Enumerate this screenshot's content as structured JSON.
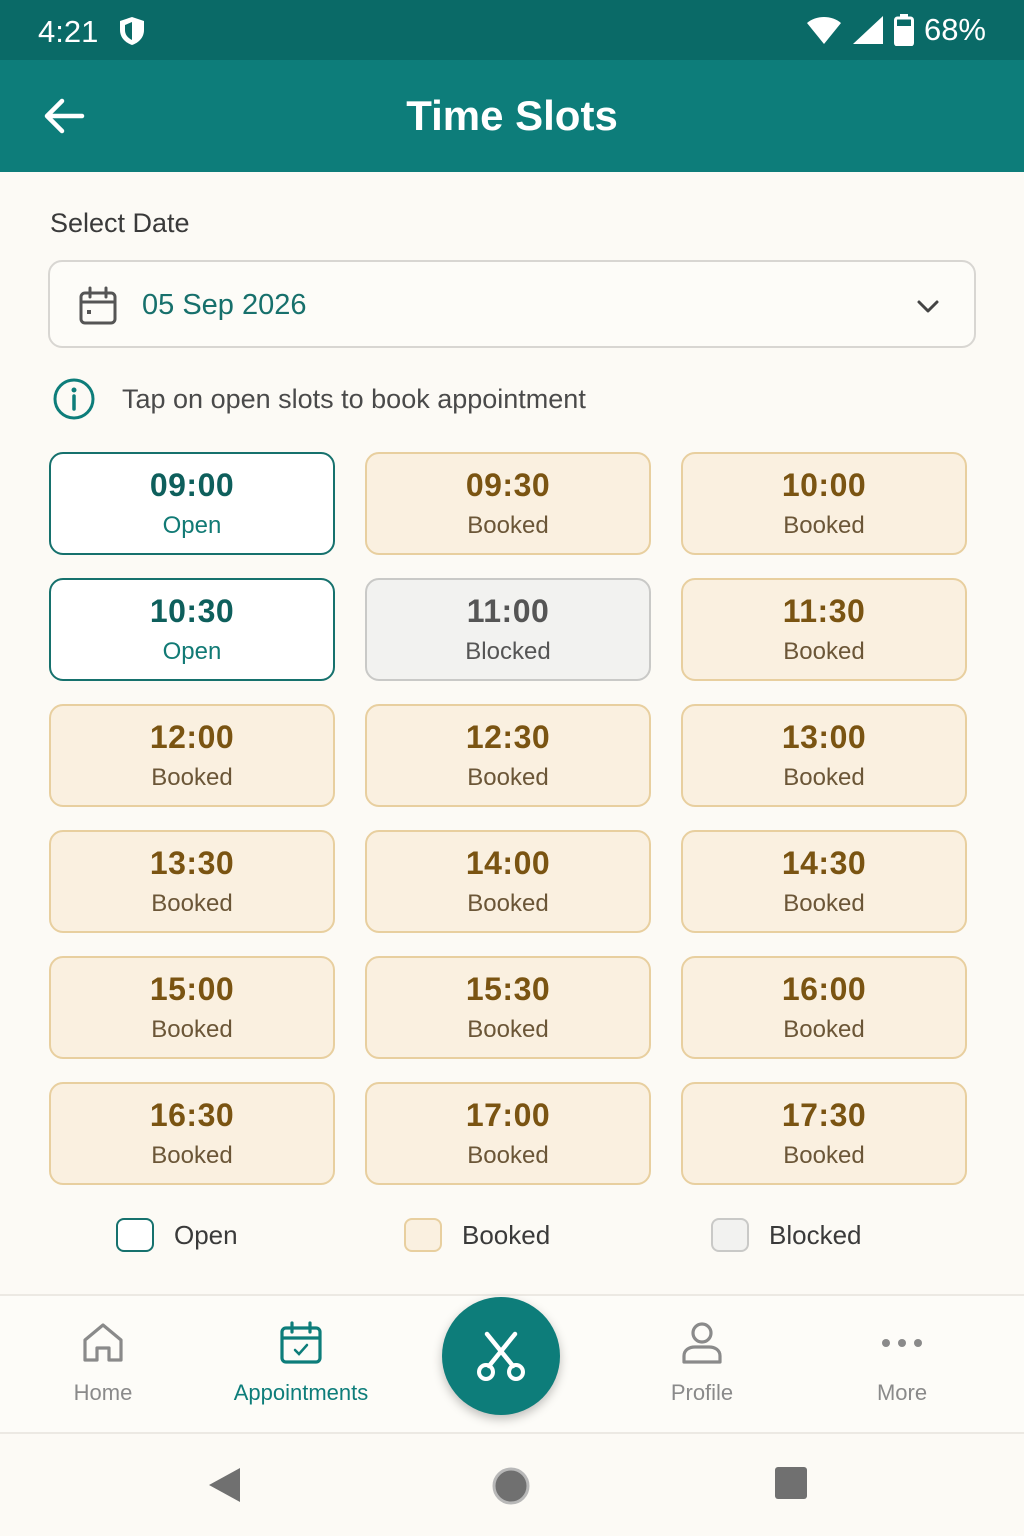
{
  "status_bar": {
    "time": "4:21",
    "battery": "68%"
  },
  "app_bar": {
    "title": "Time Slots"
  },
  "date_picker": {
    "label": "Select Date",
    "value": "05 Sep 2026"
  },
  "info": {
    "text": "Tap on open slots to book appointment"
  },
  "slots": [
    {
      "time": "09:00",
      "status": "Open",
      "state": "open"
    },
    {
      "time": "09:30",
      "status": "Booked",
      "state": "booked"
    },
    {
      "time": "10:00",
      "status": "Booked",
      "state": "booked"
    },
    {
      "time": "10:30",
      "status": "Open",
      "state": "open"
    },
    {
      "time": "11:00",
      "status": "Blocked",
      "state": "blocked"
    },
    {
      "time": "11:30",
      "status": "Booked",
      "state": "booked"
    },
    {
      "time": "12:00",
      "status": "Booked",
      "state": "booked"
    },
    {
      "time": "12:30",
      "status": "Booked",
      "state": "booked"
    },
    {
      "time": "13:00",
      "status": "Booked",
      "state": "booked"
    },
    {
      "time": "13:30",
      "status": "Booked",
      "state": "booked"
    },
    {
      "time": "14:00",
      "status": "Booked",
      "state": "booked"
    },
    {
      "time": "14:30",
      "status": "Booked",
      "state": "booked"
    },
    {
      "time": "15:00",
      "status": "Booked",
      "state": "booked"
    },
    {
      "time": "15:30",
      "status": "Booked",
      "state": "booked"
    },
    {
      "time": "16:00",
      "status": "Booked",
      "state": "booked"
    },
    {
      "time": "16:30",
      "status": "Booked",
      "state": "booked"
    },
    {
      "time": "17:00",
      "status": "Booked",
      "state": "booked"
    },
    {
      "time": "17:30",
      "status": "Booked",
      "state": "booked"
    }
  ],
  "legend": [
    {
      "label": "Open",
      "state": "open"
    },
    {
      "label": "Booked",
      "state": "booked"
    },
    {
      "label": "Blocked",
      "state": "blocked"
    }
  ],
  "bottom_nav": {
    "home": "Home",
    "appointments": "Appointments",
    "profile": "Profile",
    "more": "More",
    "active": "appointments",
    "fab_icon": "scissors-icon"
  },
  "colors": {
    "primary": "#0d7d7a",
    "status_bar": "#0a6a67",
    "booked_bg": "#faf0e0",
    "booked_border": "#e8cf9f",
    "blocked_bg": "#f2f2f0",
    "open_border": "#16716d"
  }
}
